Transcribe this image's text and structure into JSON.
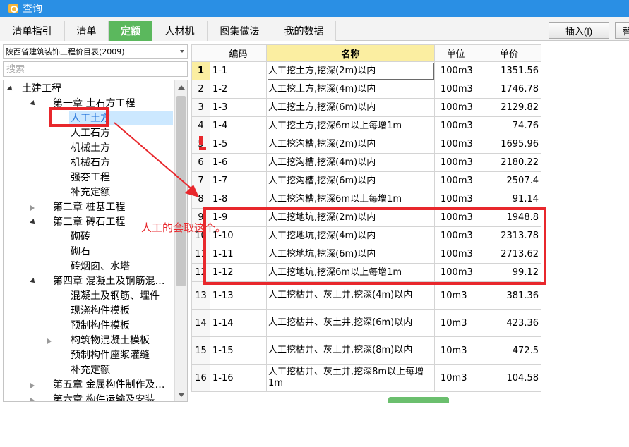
{
  "window": {
    "title": "查询"
  },
  "tabs": [
    {
      "label": "清单指引",
      "active": false
    },
    {
      "label": "清单",
      "active": false
    },
    {
      "label": "定额",
      "active": true
    },
    {
      "label": "人材机",
      "active": false
    },
    {
      "label": "图集做法",
      "active": false
    },
    {
      "label": "我的数据",
      "active": false
    }
  ],
  "toolbar": {
    "insert_label": "插入(I)",
    "more_label": "替"
  },
  "sidebar": {
    "catalog": "陕西省建筑装饰工程价目表(2009)",
    "search_placeholder": "搜索",
    "tree": [
      {
        "label": "土建工程",
        "level": 0,
        "toggle": "open"
      },
      {
        "label": "第一章  土石方工程",
        "level": 1,
        "toggle": "open"
      },
      {
        "label": "人工土方",
        "level": 2,
        "toggle": "",
        "selected": true
      },
      {
        "label": "人工石方",
        "level": 2,
        "toggle": ""
      },
      {
        "label": "机械土方",
        "level": 2,
        "toggle": ""
      },
      {
        "label": "机械石方",
        "level": 2,
        "toggle": ""
      },
      {
        "label": "强夯工程",
        "level": 2,
        "toggle": ""
      },
      {
        "label": "补充定额",
        "level": 2,
        "toggle": ""
      },
      {
        "label": "第二章  桩基工程",
        "level": 1,
        "toggle": "closed"
      },
      {
        "label": "第三章  砖石工程",
        "level": 1,
        "toggle": "open"
      },
      {
        "label": "砌砖",
        "level": 2,
        "toggle": ""
      },
      {
        "label": "砌石",
        "level": 2,
        "toggle": ""
      },
      {
        "label": "砖烟囱、水塔",
        "level": 2,
        "toggle": ""
      },
      {
        "label": "第四章  混凝土及钢筋混…",
        "level": 1,
        "toggle": "open"
      },
      {
        "label": "混凝土及钢筋、埋件",
        "level": 2,
        "toggle": ""
      },
      {
        "label": "现浇构件模板",
        "level": 2,
        "toggle": ""
      },
      {
        "label": "预制构件模板",
        "level": 2,
        "toggle": ""
      },
      {
        "label": "构筑物混凝土模板",
        "level": 2,
        "toggle": "closed"
      },
      {
        "label": "预制构件座浆灌缝",
        "level": 2,
        "toggle": ""
      },
      {
        "label": "补充定额",
        "level": 2,
        "toggle": ""
      },
      {
        "label": "第五章  金属构件制作及…",
        "level": 1,
        "toggle": "closed"
      },
      {
        "label": "第六章  构件运输及安装",
        "level": 1,
        "toggle": "closed"
      }
    ]
  },
  "table": {
    "headers": [
      "编码",
      "名称",
      "单位",
      "单价"
    ],
    "rows": [
      {
        "idx": "1",
        "code": "1-1",
        "name": "人工挖土方,挖深(2m)以内",
        "unit": "100m3",
        "price": "1351.56"
      },
      {
        "idx": "2",
        "code": "1-2",
        "name": "人工挖土方,挖深(4m)以内",
        "unit": "100m3",
        "price": "1746.78"
      },
      {
        "idx": "3",
        "code": "1-3",
        "name": "人工挖土方,挖深(6m)以内",
        "unit": "100m3",
        "price": "2129.82"
      },
      {
        "idx": "4",
        "code": "1-4",
        "name": "人工挖土方,挖深6m以上每增1m",
        "unit": "100m3",
        "price": "74.76"
      },
      {
        "idx": "5",
        "code": "1-5",
        "name": "人工挖沟槽,挖深(2m)以内",
        "unit": "100m3",
        "price": "1695.96"
      },
      {
        "idx": "6",
        "code": "1-6",
        "name": "人工挖沟槽,挖深(4m)以内",
        "unit": "100m3",
        "price": "2180.22"
      },
      {
        "idx": "7",
        "code": "1-7",
        "name": "人工挖沟槽,挖深(6m)以内",
        "unit": "100m3",
        "price": "2507.4"
      },
      {
        "idx": "8",
        "code": "1-8",
        "name": "人工挖沟槽,挖深6m以上每增1m",
        "unit": "100m3",
        "price": "91.14"
      },
      {
        "idx": "9",
        "code": "1-9",
        "name": "人工挖地坑,挖深(2m)以内",
        "unit": "100m3",
        "price": "1948.8"
      },
      {
        "idx": "10",
        "code": "1-10",
        "name": "人工挖地坑,挖深(4m)以内",
        "unit": "100m3",
        "price": "2313.78"
      },
      {
        "idx": "11",
        "code": "1-11",
        "name": "人工挖地坑,挖深(6m)以内",
        "unit": "100m3",
        "price": "2713.62"
      },
      {
        "idx": "12",
        "code": "1-12",
        "name": "人工挖地坑,挖深6m以上每增1m",
        "unit": "100m3",
        "price": "99.12"
      },
      {
        "idx": "13",
        "code": "1-13",
        "name": "人工挖枯井、灰土井,挖深(4m)以内",
        "unit": "10m3",
        "price": "381.36"
      },
      {
        "idx": "14",
        "code": "1-14",
        "name": "人工挖枯井、灰土井,挖深(6m)以内",
        "unit": "10m3",
        "price": "423.36"
      },
      {
        "idx": "15",
        "code": "1-15",
        "name": "人工挖枯井、灰土井,挖深(8m)以内",
        "unit": "10m3",
        "price": "472.5"
      },
      {
        "idx": "16",
        "code": "1-16",
        "name": "人工挖枯井、灰土井,挖深8m以上每增1m",
        "unit": "10m3",
        "price": "104.58"
      }
    ]
  },
  "annotation": {
    "text": "人工的套取这个。",
    "color": "#e8272c"
  }
}
